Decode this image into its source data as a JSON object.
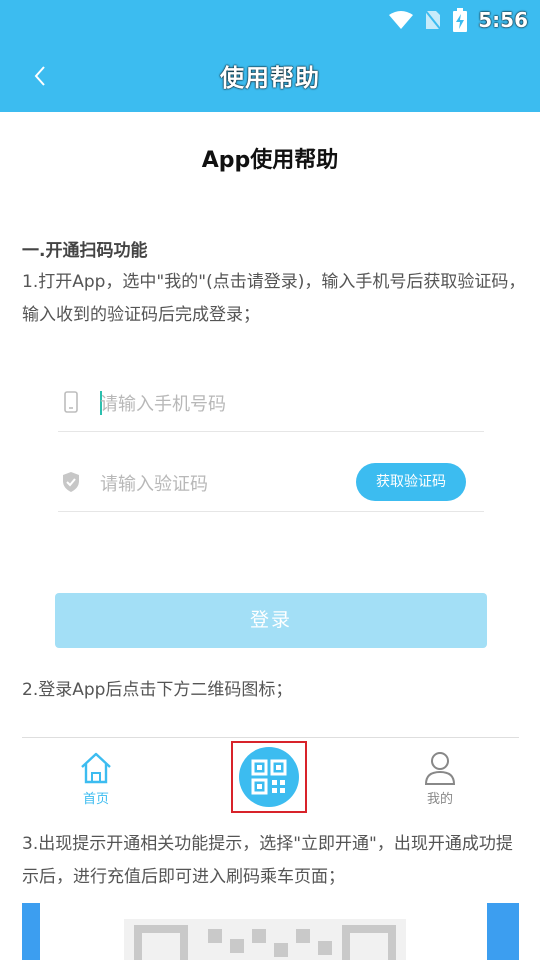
{
  "status_bar": {
    "time": "5:56",
    "icons": [
      "wifi-icon",
      "no-sim-icon",
      "battery-charging-icon"
    ]
  },
  "topbar": {
    "back_icon": "chevron-left-icon",
    "title": "使用帮助"
  },
  "doc": {
    "title": "App使用帮助",
    "section1_heading": "一.开通扫码功能",
    "step1": "1.打开App，选中\"我的\"(点击请登录)，输入手机号后获取验证码，输入收到的验证码后完成登录；",
    "step2": "2.登录App后点击下方二维码图标；",
    "step3": "3.出现提示开通相关功能提示，选择\"立即开通\"，出现开通成功提示后，进行充值后即可进入刷码乘车页面；"
  },
  "login_mock": {
    "phone_placeholder": "请输入手机号码",
    "code_placeholder": "请输入验证码",
    "get_code_label": "获取验证码",
    "login_label": "登录",
    "phone_icon": "phone-icon",
    "shield_icon": "shield-check-icon"
  },
  "tabbar_mock": {
    "home_label": "首页",
    "mine_label": "我的",
    "home_icon": "home-icon",
    "qr_icon": "qr-code-icon",
    "mine_icon": "user-icon"
  },
  "colors": {
    "primary": "#3cbcf0",
    "login_disabled": "#a3dff6",
    "highlight": "#d8232a",
    "text_body": "#555555"
  }
}
